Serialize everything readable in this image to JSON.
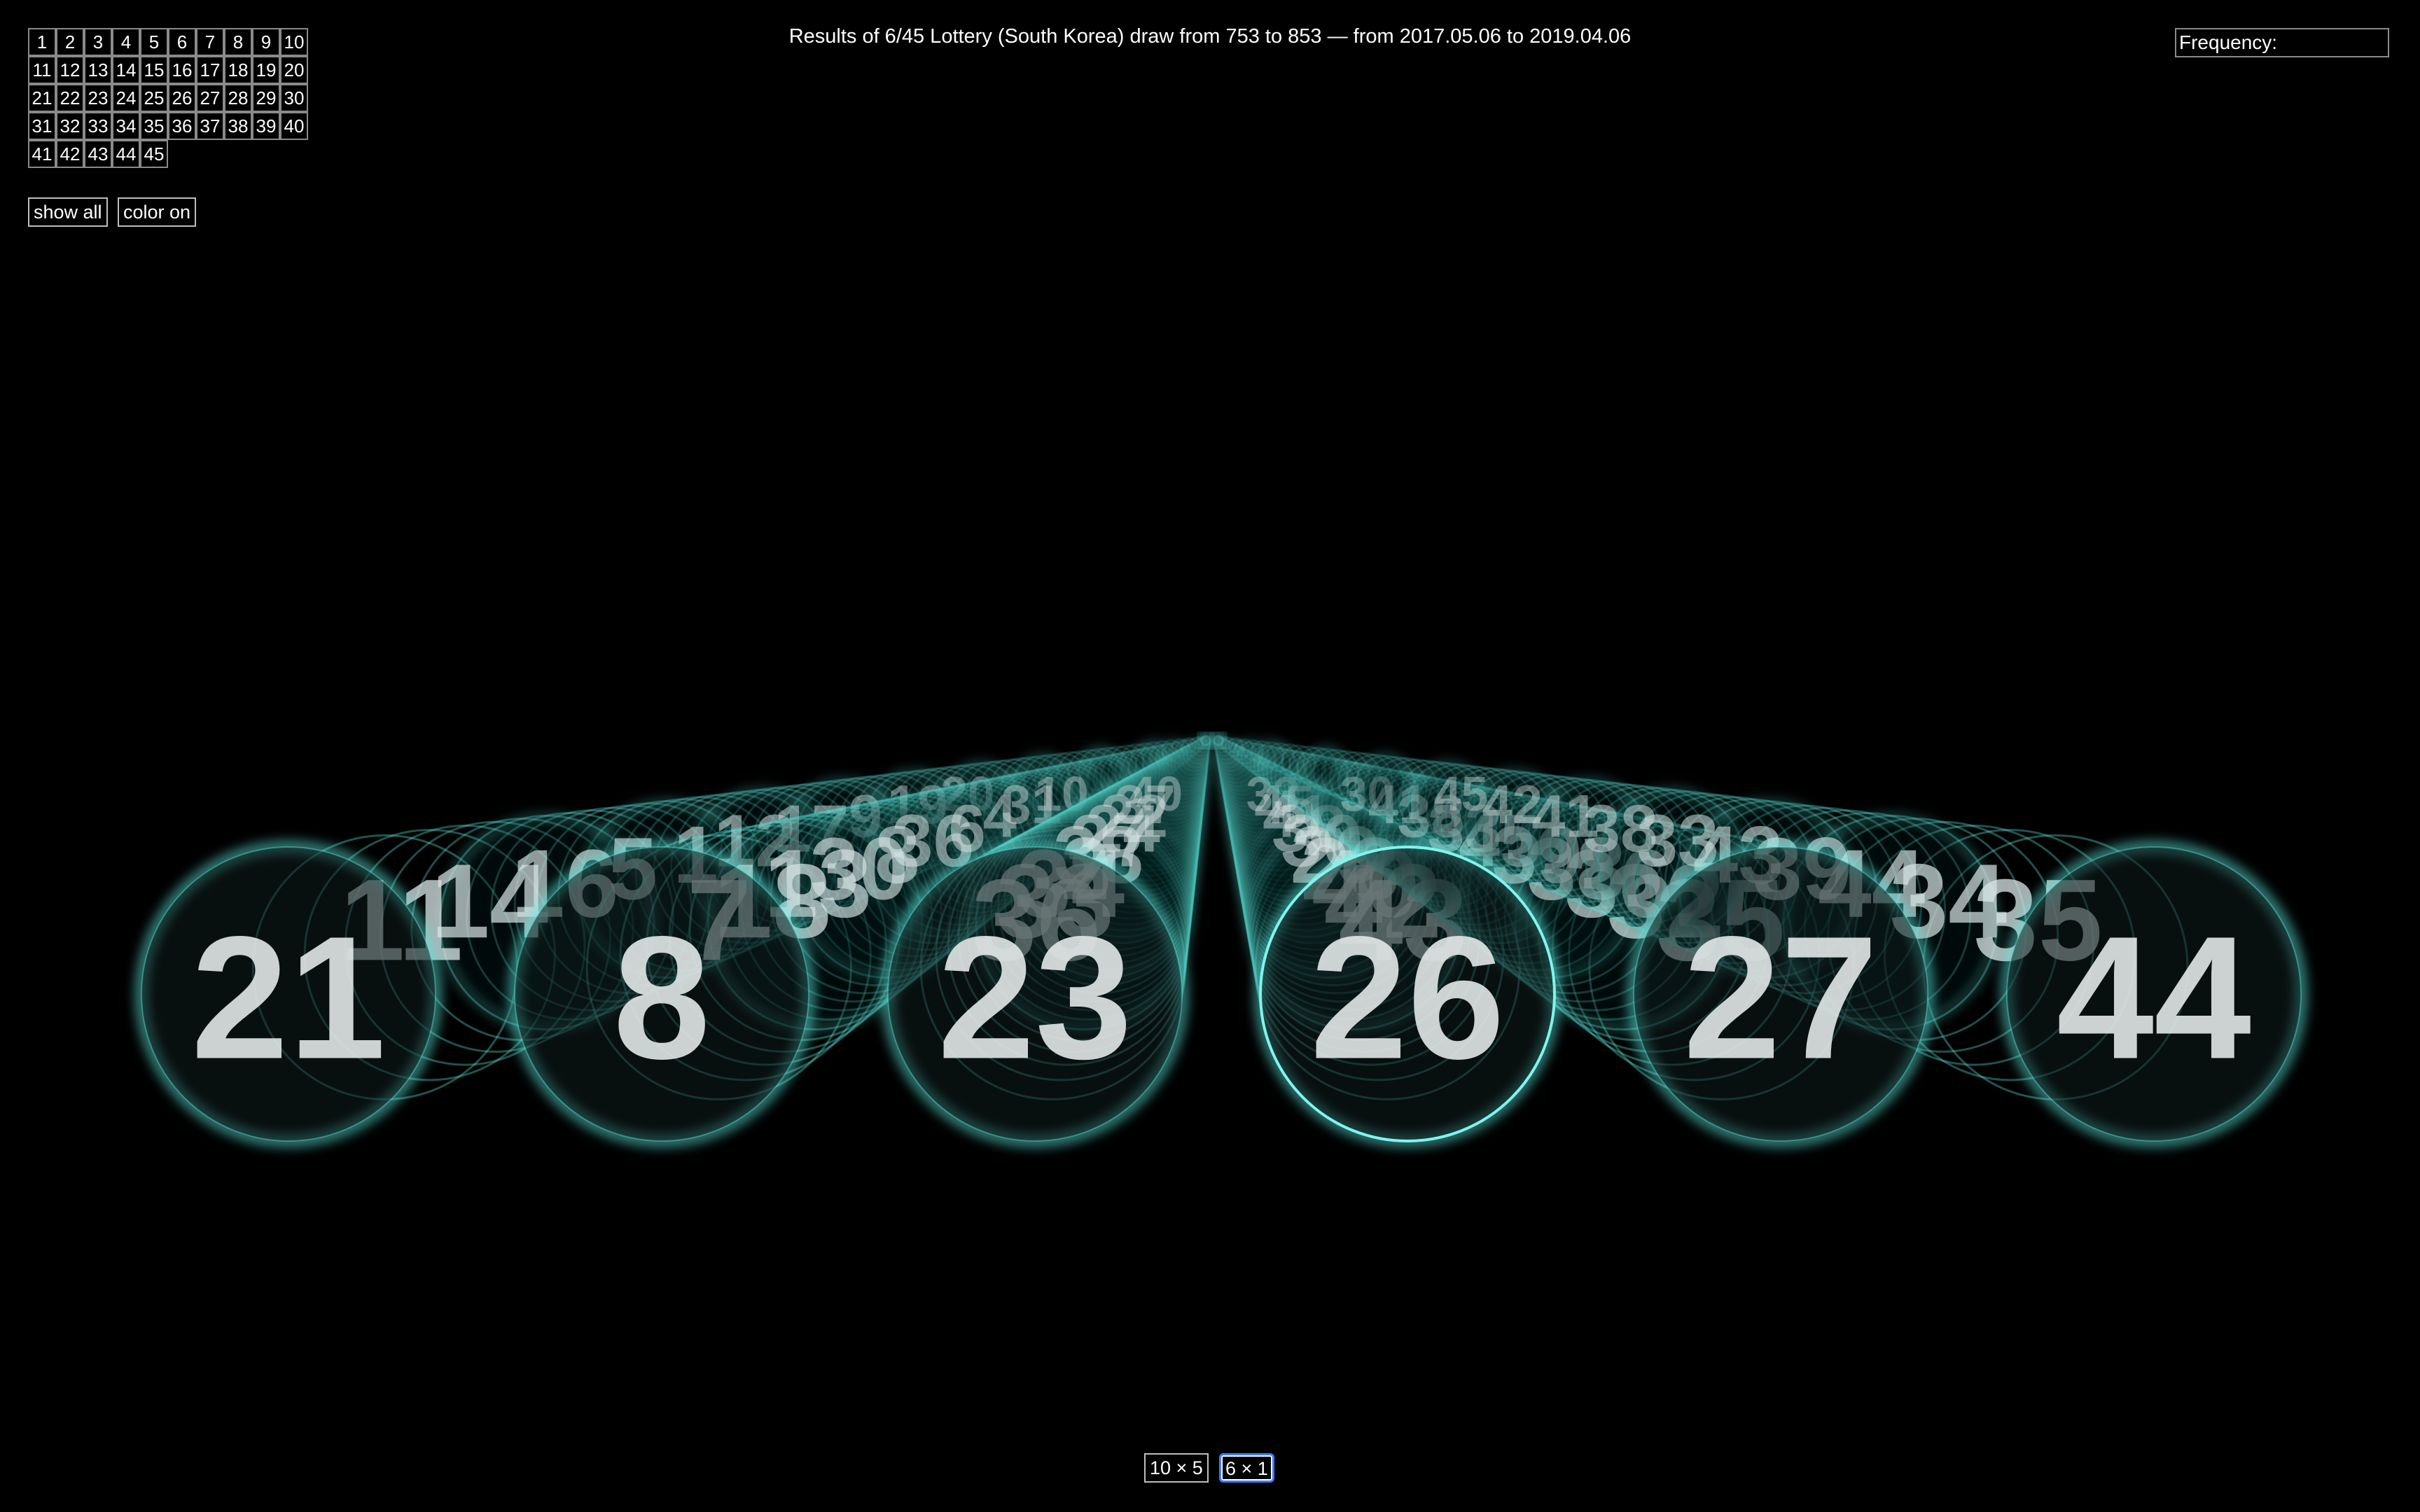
{
  "title": "Results of 6/45 Lottery (South Korea) draw from 753 to 853 — from 2017.05.06 to 2019.04.06",
  "frequency_label": "Frequency:",
  "controls": {
    "show_all": "show all",
    "color_on": "color on"
  },
  "layout_buttons": {
    "ten_by_five": "10 × 5",
    "six_by_one": "6 × 1",
    "selected": "6 × 1"
  },
  "number_grid": [
    "1",
    "2",
    "3",
    "4",
    "5",
    "6",
    "7",
    "8",
    "9",
    "10",
    "11",
    "12",
    "13",
    "14",
    "15",
    "16",
    "17",
    "18",
    "19",
    "20",
    "21",
    "22",
    "23",
    "24",
    "25",
    "26",
    "27",
    "28",
    "29",
    "30",
    "31",
    "32",
    "33",
    "34",
    "35",
    "36",
    "37",
    "38",
    "39",
    "40",
    "41",
    "42",
    "43",
    "44",
    "45"
  ],
  "colors": {
    "background": "#000000",
    "glow": "#5ff0e6",
    "highlight_ring": "#7ff5ee",
    "ball_fill": "#0f1c1c"
  },
  "front_balls": [
    {
      "number": "21",
      "highlighted": false
    },
    {
      "number": "8",
      "highlighted": false
    },
    {
      "number": "23",
      "highlighted": false
    },
    {
      "number": "26",
      "highlighted": true
    },
    {
      "number": "27",
      "highlighted": false
    },
    {
      "number": "44",
      "highlighted": false
    }
  ],
  "receding_numbers": {
    "lane1": [
      "11",
      "14",
      "16",
      "5",
      "1",
      "12",
      "17",
      "9",
      "19",
      "20"
    ],
    "lane2": [
      "7",
      "18",
      "13",
      "30",
      "8",
      "36",
      "6",
      "4",
      "31",
      "10"
    ],
    "lane3": [
      "36",
      "33",
      "34",
      "2",
      "38",
      "27",
      "24",
      "22",
      "37",
      "40"
    ],
    "lane4": [
      "43",
      "42",
      "40",
      "28",
      "29",
      "30",
      "38",
      "41",
      "45",
      "33"
    ],
    "lane5": [
      "35",
      "32",
      "36",
      "38",
      "39",
      "45",
      "33",
      "38",
      "41",
      "30"
    ],
    "lane6": [
      "35",
      "34",
      "44",
      "39",
      "43",
      "33",
      "38",
      "41",
      "42",
      "45"
    ]
  }
}
